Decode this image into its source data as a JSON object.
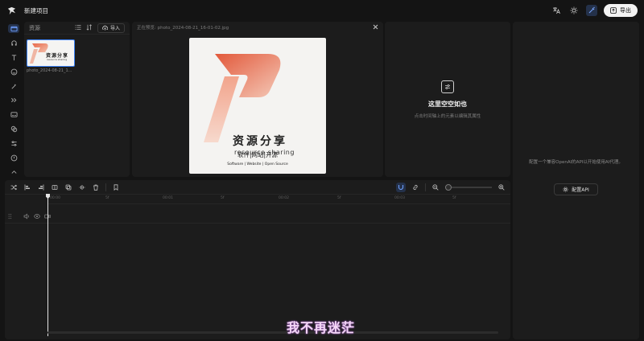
{
  "app": {
    "title": "新建项目"
  },
  "topbar": {
    "icons": [
      "translate-icon",
      "sun-icon",
      "magic-wand-icon"
    ],
    "export_label": "导出"
  },
  "rail": {
    "items": [
      "folder-icon",
      "audio-icon",
      "text-icon",
      "sticker-icon",
      "effects-icon",
      "transition-icon",
      "subtitle-icon",
      "filter-icon",
      "adjust-icon",
      "template-icon",
      "ai-icon"
    ]
  },
  "assets": {
    "title": "资源",
    "import_label": "导入",
    "items": [
      {
        "name": "photo_2024-08-21_1...",
        "thumb_zh": "资源分享",
        "thumb_en": "resource sharing"
      }
    ]
  },
  "preview": {
    "title": "正在预览: photo_2024-08-21_16-01-02.jpg",
    "image": {
      "zh": "资源分享",
      "en": "resource sharing",
      "line1": "软件|网站|开源",
      "line2": "Software | Website | Open Source"
    }
  },
  "empty": {
    "title": "这里空空如也",
    "desc": "点击时间轴上的元素以编辑其属性"
  },
  "ai": {
    "desc": "配置一个兼容OpenAI的API以开始使用AI代理。",
    "button_label": "配置API"
  },
  "timeline": {
    "ticks": [
      "00:00",
      "5f",
      "00:01",
      "5f",
      "00:02",
      "5f",
      "00:03",
      "5f"
    ]
  },
  "overlay": {
    "subtitle": "我不再迷茫"
  }
}
